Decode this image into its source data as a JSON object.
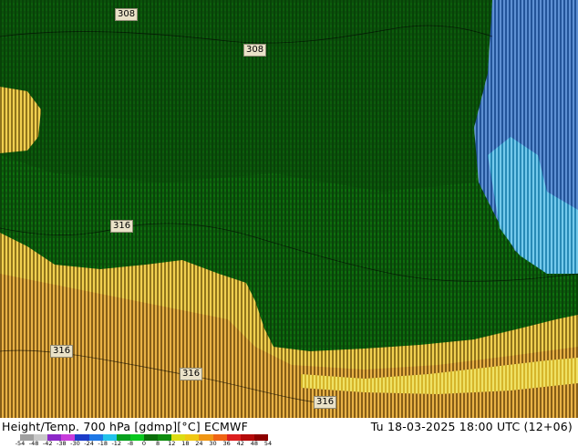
{
  "contour_labels": [
    "308",
    "308",
    "316",
    "316",
    "316",
    "316"
  ],
  "footer": {
    "title": "Height/Temp. 700 hPa [gdmp][°C] ECMWF",
    "datetime": "Tu 18-03-2025 18:00 UTC (12+06)"
  },
  "colorbar": {
    "colors": [
      "#a0a0a0",
      "#c8c8c8",
      "#8c28c8",
      "#c83cdc",
      "#1c3cc8",
      "#1e78e6",
      "#23c3eb",
      "#07a01e",
      "#09c81e",
      "#0a6e0a",
      "#0e8c0e",
      "#dcdc14",
      "#f0c814",
      "#f09614",
      "#f06414",
      "#dc1e1e",
      "#b40a0a",
      "#8c0000"
    ],
    "tick_labels": [
      "-54",
      "-48",
      "-42",
      "-38",
      "-30",
      "-24",
      "-18",
      "-12",
      "-8",
      "0",
      "8",
      "12",
      "18",
      "24",
      "30",
      "36",
      "42",
      "48",
      "54"
    ]
  },
  "palette": {
    "green_dark": "#0c5a0c",
    "green_mid": "#107a10",
    "green_line": "#042004",
    "blue": "#3c82d2",
    "cyan": "#3cc8f0",
    "yellow": "#f5d82a",
    "orange": "#e8a82a",
    "bright_yellow": "#ffff5a"
  }
}
